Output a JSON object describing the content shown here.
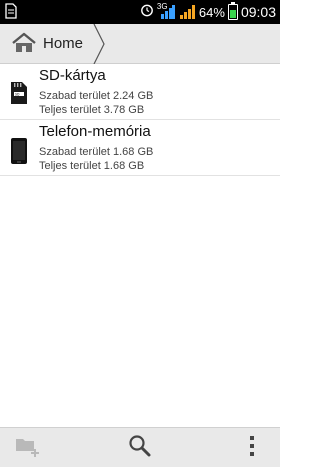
{
  "status_bar": {
    "network_type": "3G",
    "battery_percent": "64%",
    "battery_level": 0.64,
    "time": "09:03",
    "battery_color": "#3ad14d",
    "signal_color": "#f5a623",
    "data_signal_color": "#3aa0ff"
  },
  "actionbar": {
    "home_label": "Home",
    "home_icon": "home-icon"
  },
  "storage": [
    {
      "title": "SD-kártya",
      "free": "Szabad terület 2.24 GB",
      "total": "Teljes terület 3.78 GB",
      "icon": "sd-card-icon"
    },
    {
      "title": "Telefon-memória",
      "free": "Szabad terület 1.68 GB",
      "total": "Teljes terület 1.68 GB",
      "icon": "phone-memory-icon"
    }
  ],
  "bottom_bar": {
    "new_folder_icon": "new-folder-icon",
    "search_icon": "search-icon",
    "menu_icon": "overflow-menu-icon"
  }
}
